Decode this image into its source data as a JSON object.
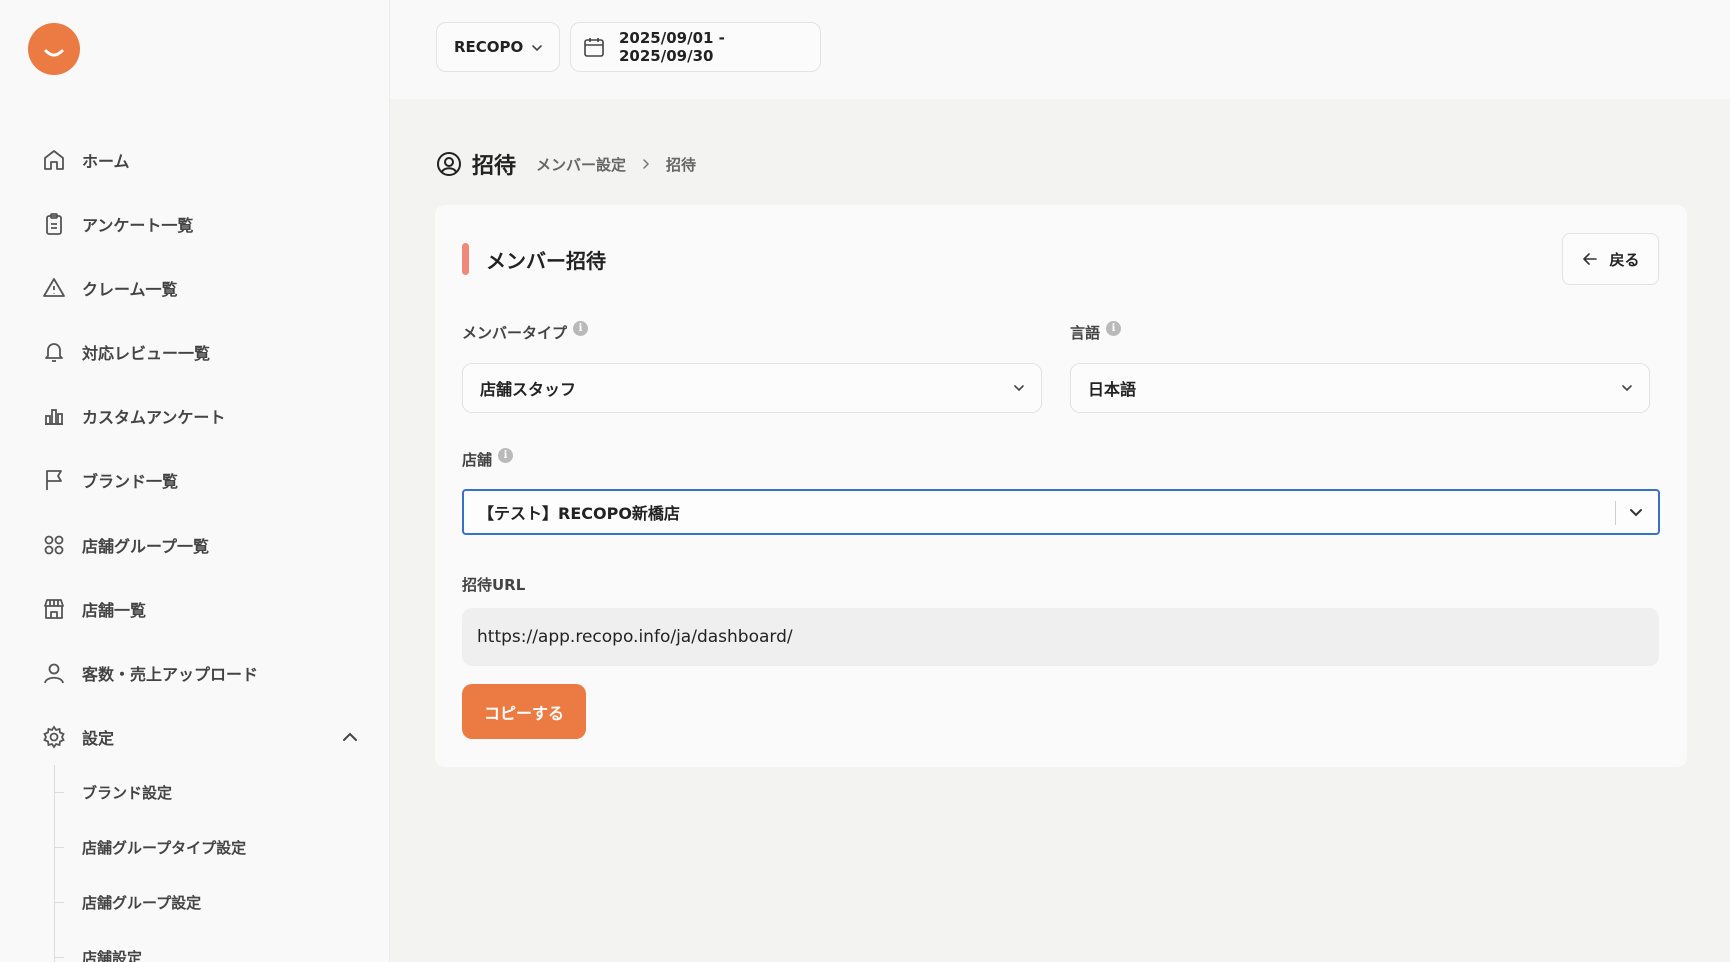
{
  "sidebar": {
    "items": [
      {
        "label": "ホーム",
        "icon": "home-icon"
      },
      {
        "label": "アンケート一覧",
        "icon": "clipboard-icon"
      },
      {
        "label": "クレーム一覧",
        "icon": "warning-icon"
      },
      {
        "label": "対応レビュー一覧",
        "icon": "bell-icon"
      },
      {
        "label": "カスタムアンケート",
        "icon": "chart-icon"
      },
      {
        "label": "ブランド一覧",
        "icon": "flag-icon"
      },
      {
        "label": "店舗グループ一覧",
        "icon": "grid-icon"
      },
      {
        "label": "店舗一覧",
        "icon": "store-icon"
      },
      {
        "label": "客数・売上アップロード",
        "icon": "user-icon"
      },
      {
        "label": "設定",
        "icon": "gear-icon"
      }
    ],
    "sub_items": [
      {
        "label": "ブランド設定"
      },
      {
        "label": "店舗グループタイプ設定"
      },
      {
        "label": "店舗グループ設定"
      },
      {
        "label": "店舗設定"
      }
    ]
  },
  "topbar": {
    "brand_select": "RECOPO",
    "date_range": "2025/09/01 - 2025/09/30"
  },
  "page": {
    "title": "招待",
    "breadcrumb": [
      "メンバー設定",
      "招待"
    ]
  },
  "card": {
    "title": "メンバー招待",
    "back_label": "戻る",
    "member_type_label": "メンバータイプ",
    "member_type_value": "店舗スタッフ",
    "language_label": "言語",
    "language_value": "日本語",
    "store_label": "店舗",
    "store_value": "【テスト】RECOPO新橋店",
    "invite_url_label": "招待URL",
    "invite_url_value": "https://app.recopo.info/ja/dashboard/",
    "copy_label": "コピーする"
  },
  "colors": {
    "accent": "#ec7a43",
    "focus": "#3a70c8",
    "title_bar": "#ef8a7a"
  }
}
